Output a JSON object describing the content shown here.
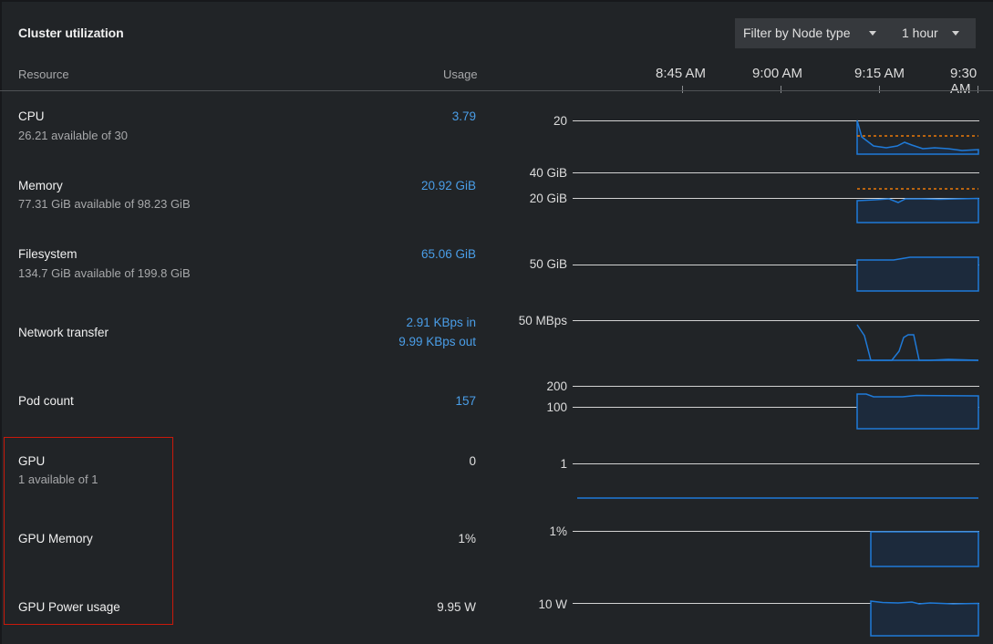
{
  "header": {
    "title": "Cluster utilization",
    "filter_label": "Filter by Node type",
    "time_range": "1 hour"
  },
  "columns": {
    "resource": "Resource",
    "usage": "Usage"
  },
  "time_axis": [
    "8:45 AM",
    "9:00 AM",
    "9:15 AM",
    "9:30 AM"
  ],
  "rows": [
    {
      "name": "CPU",
      "sub": "26.21 available of 30",
      "usage": "3.79",
      "axis": [
        "20"
      ]
    },
    {
      "name": "Memory",
      "sub": "77.31 GiB available of 98.23 GiB",
      "usage": "20.92 GiB",
      "axis": [
        "40 GiB",
        "20 GiB"
      ]
    },
    {
      "name": "Filesystem",
      "sub": "134.7 GiB available of 199.8 GiB",
      "usage": "65.06 GiB",
      "axis": [
        "50 GiB"
      ]
    },
    {
      "name": "Network transfer",
      "usage_in": "2.91 KBps in",
      "usage_out": "9.99 KBps out",
      "axis": [
        "50 MBps"
      ]
    },
    {
      "name": "Pod count",
      "usage": "157",
      "axis": [
        "200",
        "100"
      ]
    },
    {
      "name": "GPU",
      "sub": "1 available of 1",
      "usage": "0",
      "axis": [
        "1"
      ]
    },
    {
      "name": "GPU Memory",
      "usage": "1%",
      "axis": [
        "1%"
      ]
    },
    {
      "name": "GPU Power usage",
      "usage": "9.95 W",
      "axis": [
        "10 W"
      ]
    }
  ],
  "colors": {
    "series": "#1f7ad8",
    "series_fill": "#1c2a3c",
    "limit_line": "#ec7a08",
    "grid": "#d2d2d2",
    "link": "#4a9ee8",
    "highlight": "#c9190b"
  }
}
